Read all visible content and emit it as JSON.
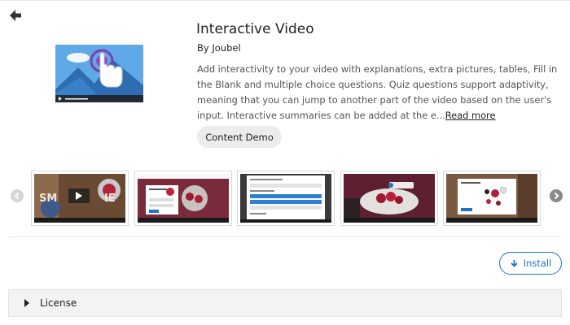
{
  "header": {
    "back_icon": "arrow-left-icon"
  },
  "content_type": {
    "title": "Interactive Video",
    "author": "By Joubel",
    "description": "Add interactivity to your video with explanations, extra pictures, tables, Fill in the Blank and multiple choice questions. Quiz questions support adaptivity, meaning that you can jump to another part of the video based on the user's input. Interactive summaries can be added at the e...",
    "read_more_label": "Read more",
    "demo_button_label": "Content Demo"
  },
  "carousel": {
    "prev_icon": "chevron-left-icon",
    "next_icon": "chevron-right-icon",
    "screenshot_count": 5
  },
  "actions": {
    "install_label": "Install",
    "install_icon": "download-arrow-icon"
  },
  "license": {
    "label": "License",
    "toggle_icon": "caret-right-icon"
  },
  "colors": {
    "accent": "#1f72c8",
    "text": "#212121",
    "muted_text": "#555555",
    "panel_bg": "#f3f3f3"
  }
}
